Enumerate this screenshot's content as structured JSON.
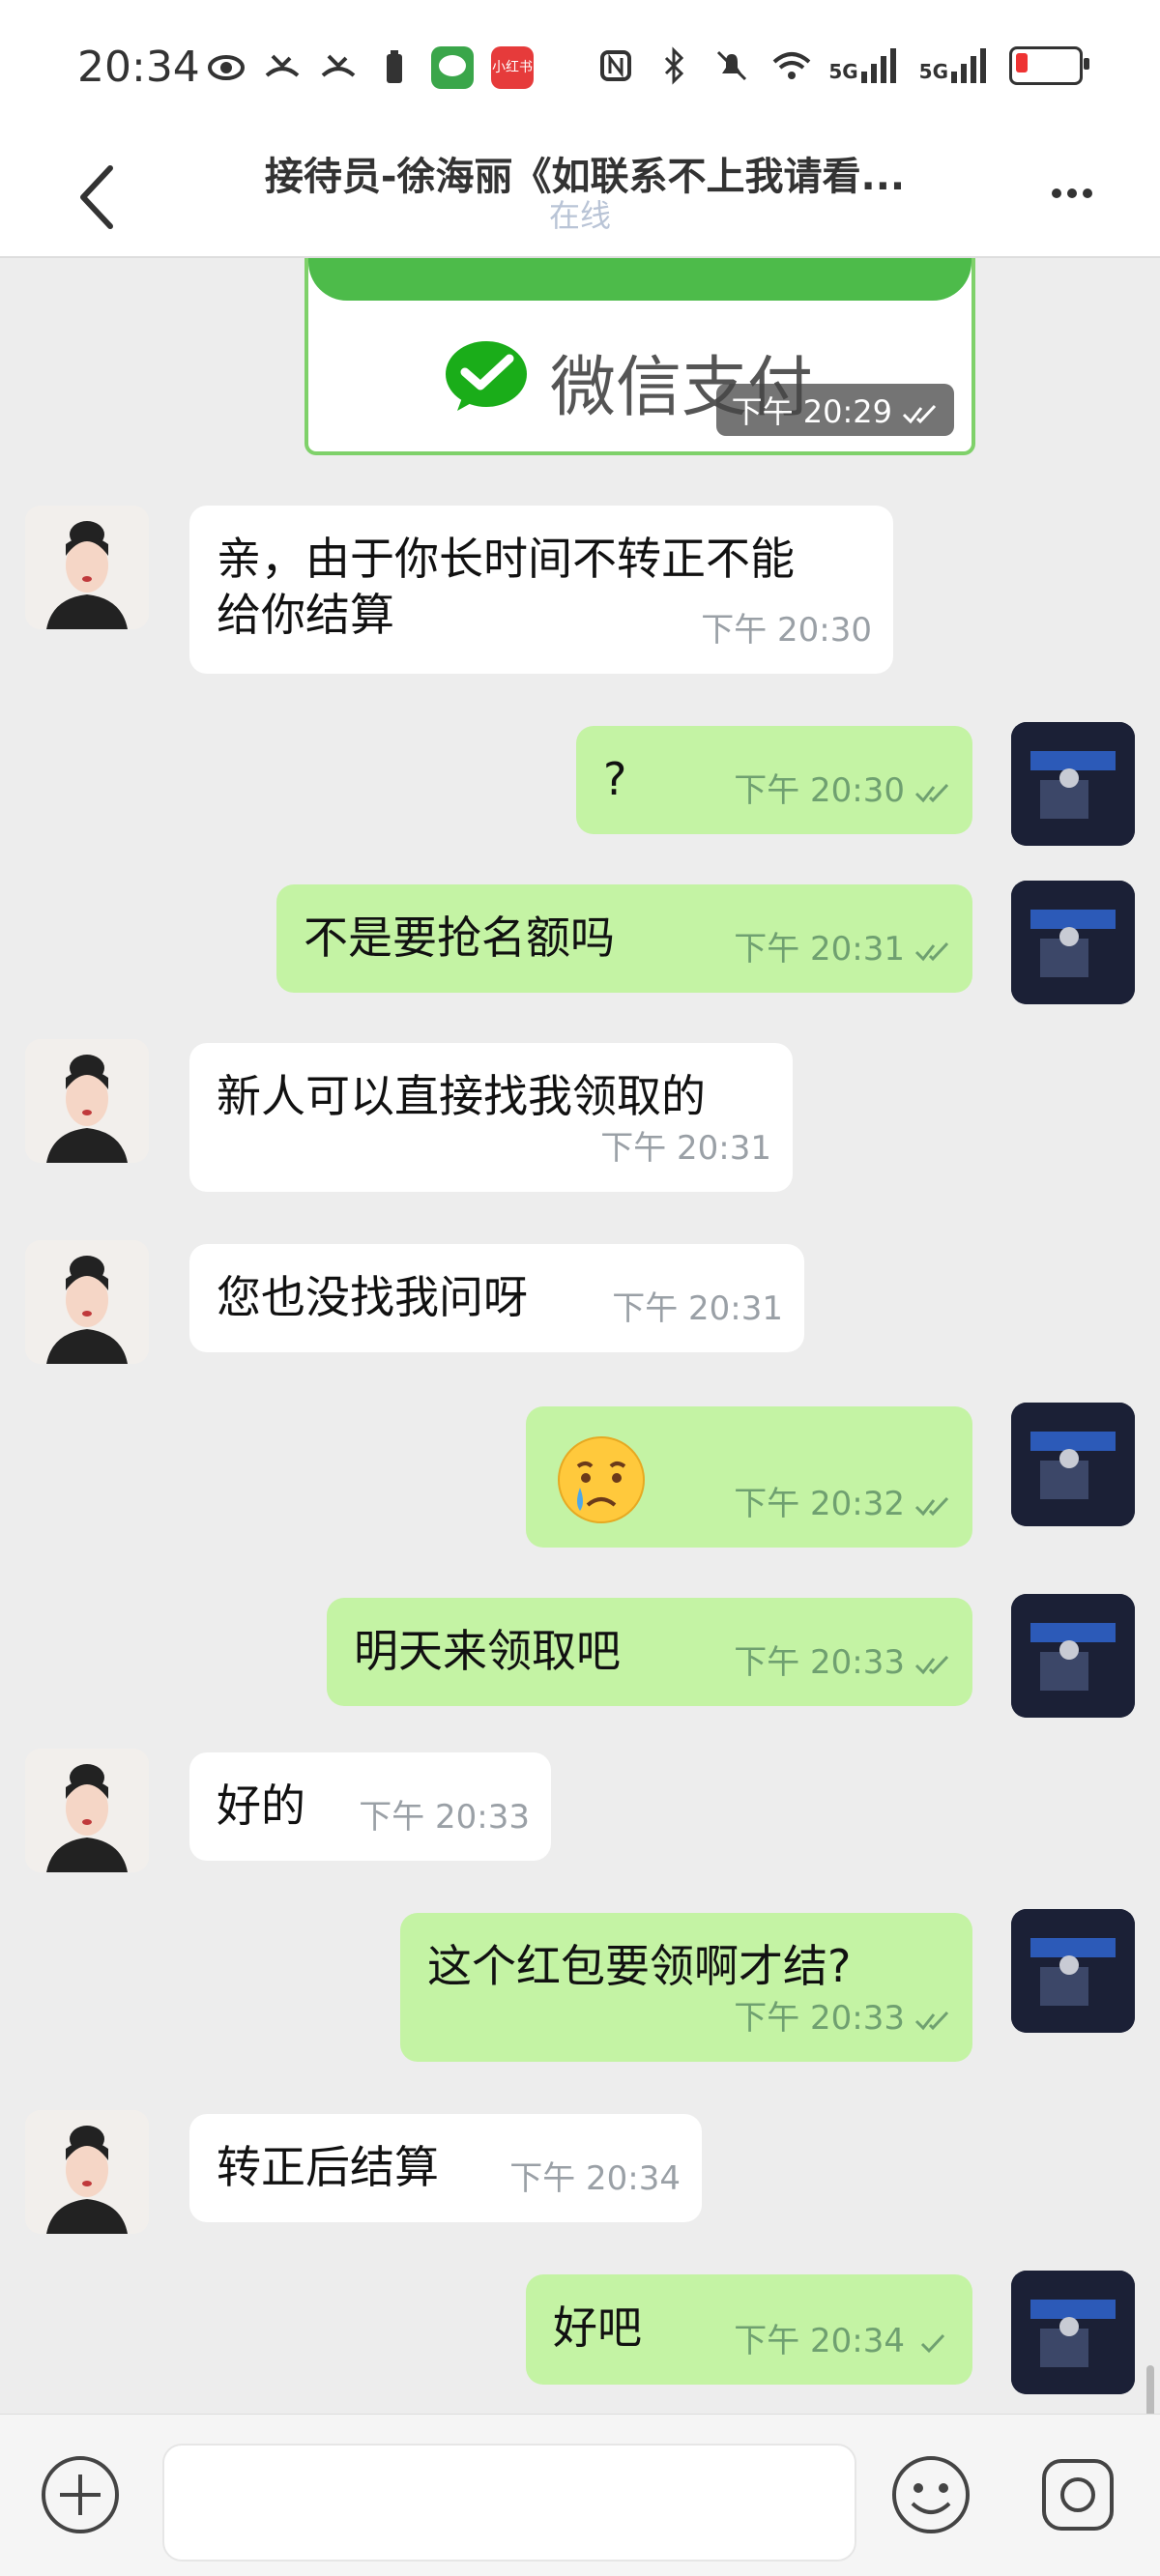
{
  "status_bar": {
    "time": "20:34",
    "app_icons": [
      "eye-icon",
      "missed-call-icon",
      "missed-call-icon",
      "battery-saver-icon",
      "wechat-app-icon",
      "xiaohongshu-app-icon"
    ],
    "xiaohongshu_label": "小红书",
    "network_1": "5G",
    "network_2": "5G"
  },
  "header": {
    "title": "接待员-徐海丽《如联系不上我请看...",
    "subtitle": "在线"
  },
  "payment_card": {
    "text": "微信支付",
    "time": "下午  20:29"
  },
  "messages": [
    {
      "side": "in",
      "text_lines": [
        "亲，由于你长时间不转正不能",
        "给你结算"
      ],
      "time": "下午  20:30"
    },
    {
      "side": "out",
      "text_lines": [
        "?"
      ],
      "time": "下午  20:30",
      "read": "double"
    },
    {
      "side": "out",
      "text_lines": [
        "不是要抢名额吗"
      ],
      "time": "下午  20:31",
      "read": "double"
    },
    {
      "side": "in",
      "text_lines": [
        "新人可以直接找我领取的"
      ],
      "time": "下午  20:31"
    },
    {
      "side": "in",
      "text_lines": [
        "您也没找我问呀"
      ],
      "time": "下午  20:31"
    },
    {
      "side": "out",
      "emoji": "😢",
      "time": "下午  20:32",
      "read": "double"
    },
    {
      "side": "out",
      "text_lines": [
        "明天来领取吧"
      ],
      "time": "下午  20:33",
      "read": "double"
    },
    {
      "side": "in",
      "text_lines": [
        "好的"
      ],
      "time": "下午  20:33"
    },
    {
      "side": "out",
      "text_lines": [
        "这个红包要领啊才结?"
      ],
      "time": "下午  20:33",
      "read": "double"
    },
    {
      "side": "in",
      "text_lines": [
        "转正后结算"
      ],
      "time": "下午  20:34"
    },
    {
      "side": "out",
      "text_lines": [
        "好吧"
      ],
      "time": "下午  20:34",
      "read": "single"
    }
  ],
  "composer": {
    "input_value": "",
    "icons": [
      "plus-icon",
      "emoji-icon",
      "camera-icon"
    ]
  },
  "colors": {
    "outgoing_bubble": "#c4f3a4",
    "incoming_bubble": "#ffffff",
    "chat_background": "#ededed",
    "wechat_green": "#4dbb4a"
  }
}
